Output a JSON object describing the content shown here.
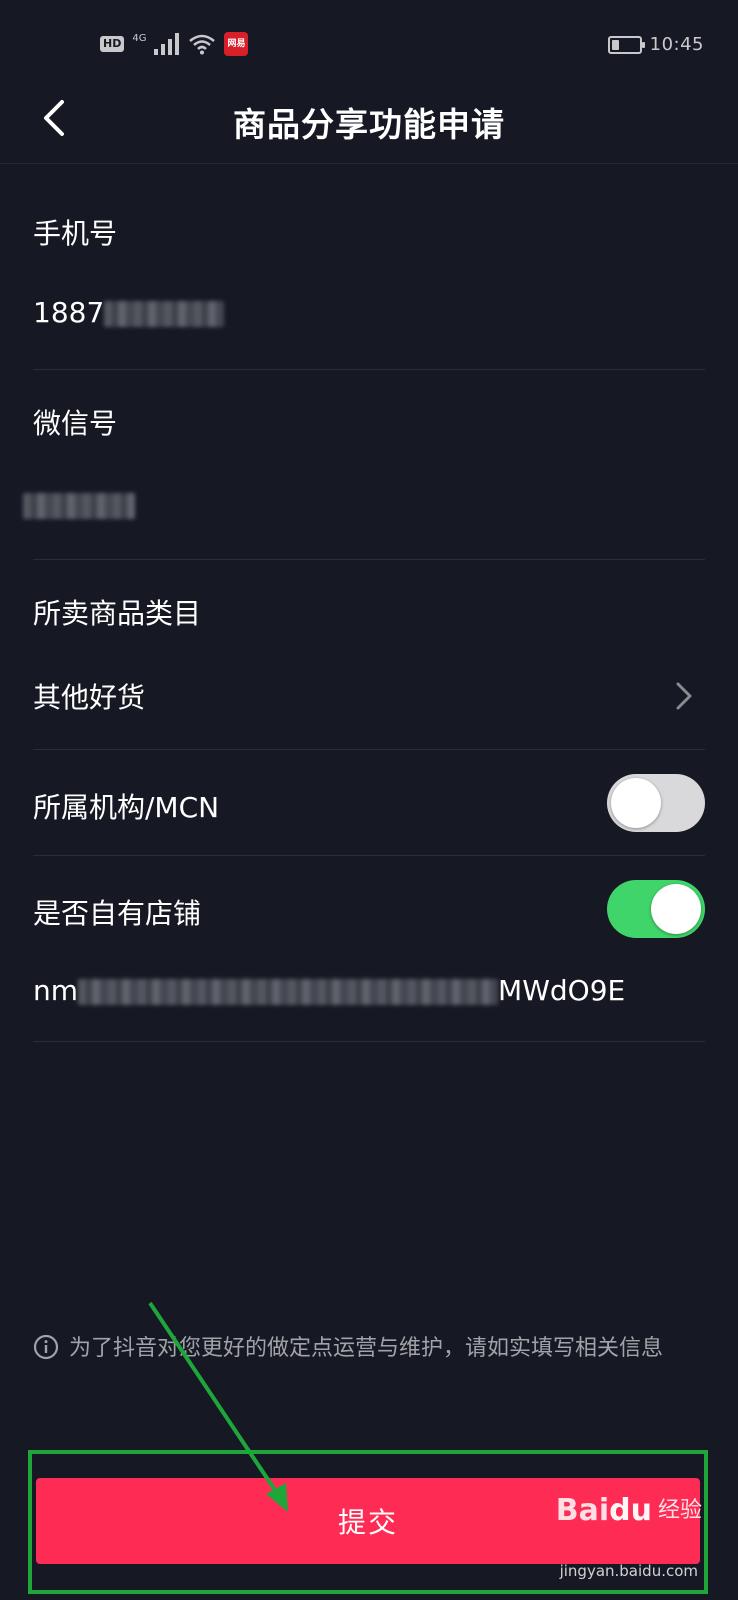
{
  "status_bar": {
    "hd": "HD",
    "network": "4G",
    "app_badge": "网易",
    "clock": "10:45",
    "battery_level": 0.25
  },
  "header": {
    "title": "商品分享功能申请"
  },
  "form": {
    "phone": {
      "label": "手机号",
      "value_visible": "1887"
    },
    "wechat": {
      "label": "微信号",
      "value_visible": ""
    },
    "category": {
      "label": "所卖商品类目",
      "value": "其他好货"
    },
    "mcn": {
      "label": "所属机构/MCN",
      "enabled": false
    },
    "shop": {
      "label": "是否自有店铺",
      "enabled": true,
      "value_visible_prefix": "nm",
      "value_visible_suffix": "MWdO9E"
    }
  },
  "notice": {
    "text": "为了抖音对您更好的做定点运营与维护，请如实填写相关信息"
  },
  "submit": {
    "label": "提交"
  },
  "watermark": {
    "logo_left": "Bai",
    "logo_mid": "du",
    "logo_cn": "经验",
    "url": "jingyan.baidu.com"
  },
  "colors": {
    "background": "#161823",
    "accent": "#fe2c55",
    "toggle_on": "#3fd56a",
    "annotation": "#1fa63b"
  }
}
